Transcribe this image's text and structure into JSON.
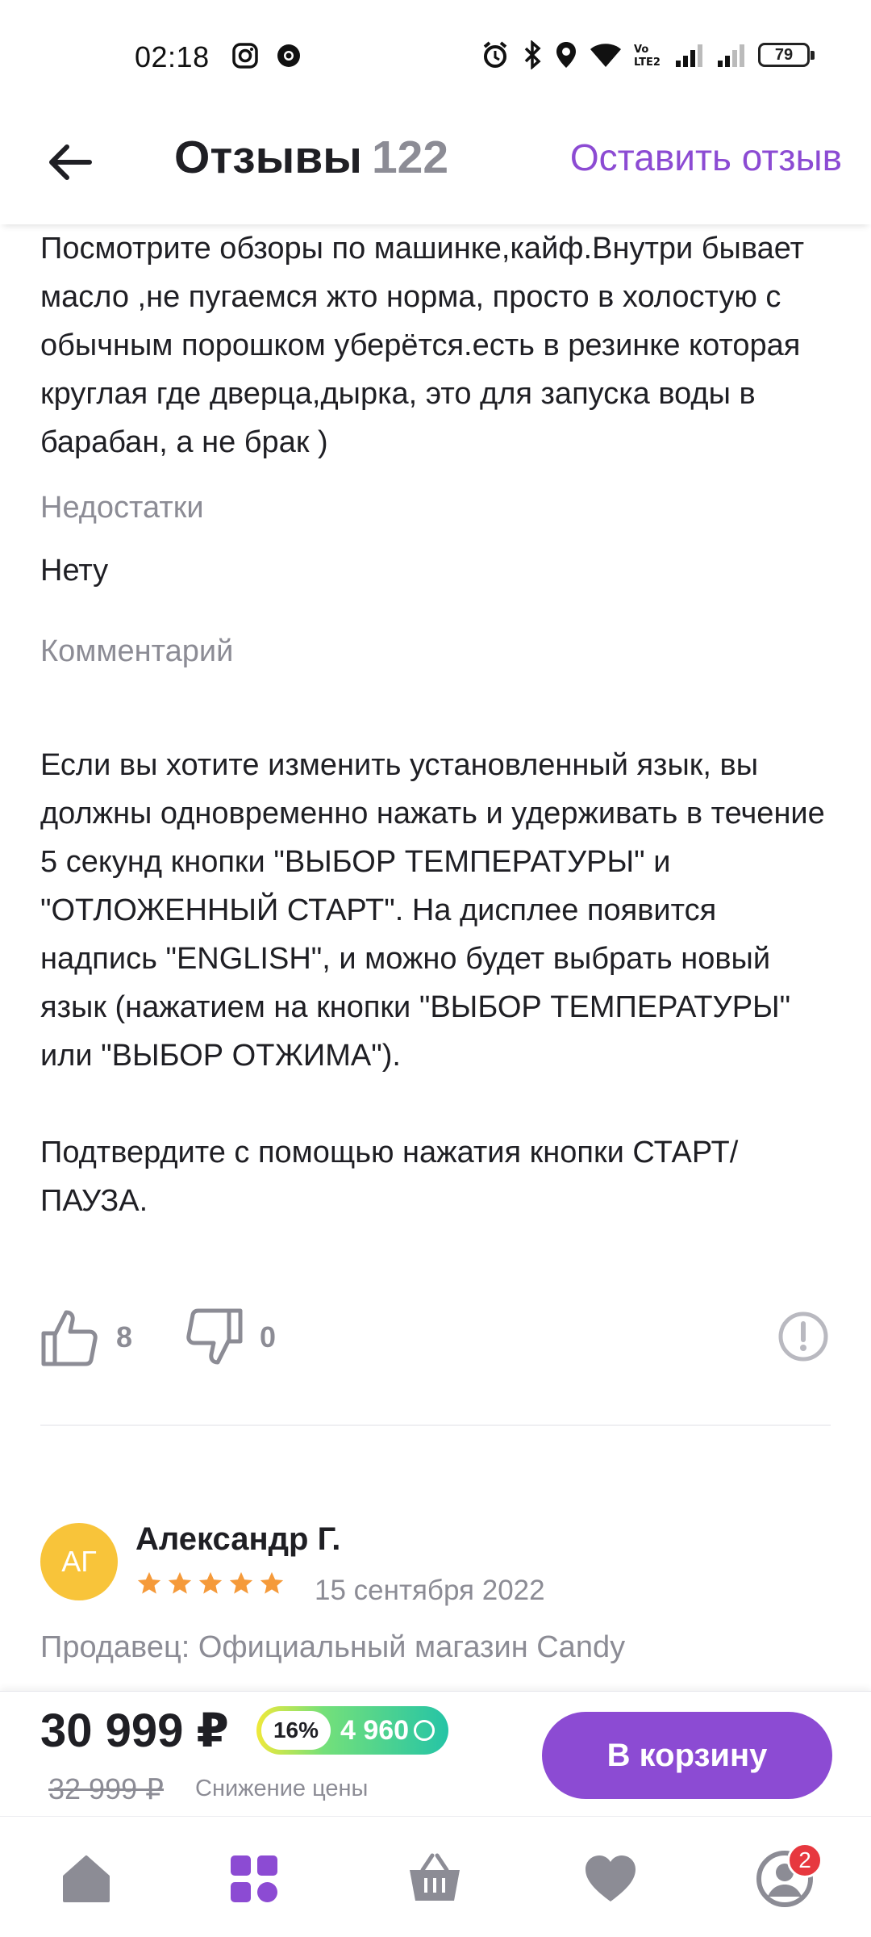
{
  "status_bar": {
    "time": "02:18",
    "battery": "79",
    "network": "LTE2"
  },
  "header": {
    "title": "Отзывы",
    "count": "122",
    "leave_review": "Оставить отзыв"
  },
  "review": {
    "pros_text": "Посмотрите обзоры по машинке,кайф.Внутри бывает масло ,не пугаемся жто норма, просто в холостую с обычным порошком уберётся.есть в резинке которая круглая где дверца,дырка, это для запуска воды в барабан, а не брак )",
    "cons_label": "Недостатки",
    "cons_text": "Нету",
    "comment_label": "Комментарий",
    "comment_text": "Если вы хотите изменить установленный язык, вы должны одновременно нажать и удерживать в течение 5 секунд кнопки \"ВЫБОР ТЕМПЕРАТУРЫ\" и \"ОТЛОЖЕННЫЙ СТАРТ\". На дисплее появится надпись \"ENGLISH\", и можно будет выбрать новый язык (нажатием на кнопки \"ВЫБОР ТЕМПЕРАТУРЫ\" или \"ВЫБОР ОТЖИМА\").",
    "comment_text2": "Подтвердите с помощью нажатия кнопки СТАРТ/ПАУЗА.",
    "likes": "8",
    "dislikes": "0"
  },
  "next_review": {
    "avatar_initials": "АГ",
    "author": "Александр Г.",
    "rating": 5,
    "date": "15 сентября 2022",
    "seller": "Продавец: Официальный магазин Candy"
  },
  "buy_bar": {
    "price": "30 999 ₽",
    "discount_percent": "16%",
    "bonus": "4 960",
    "old_price": "32 999 ₽",
    "price_note": "Снижение цены",
    "cart_button": "В корзину"
  },
  "bottom_nav": {
    "items": [
      "home-icon",
      "catalog-icon",
      "cart-icon",
      "favorites-icon",
      "profile-icon"
    ],
    "profile_badge": "2",
    "active": "catalog-icon"
  },
  "colors": {
    "accent": "#8c4bd3",
    "text": "#1f1f24",
    "muted": "#8c8c95",
    "star": "#f59a3a",
    "avatar": "#f8c43a",
    "badge": "#e7383f"
  }
}
